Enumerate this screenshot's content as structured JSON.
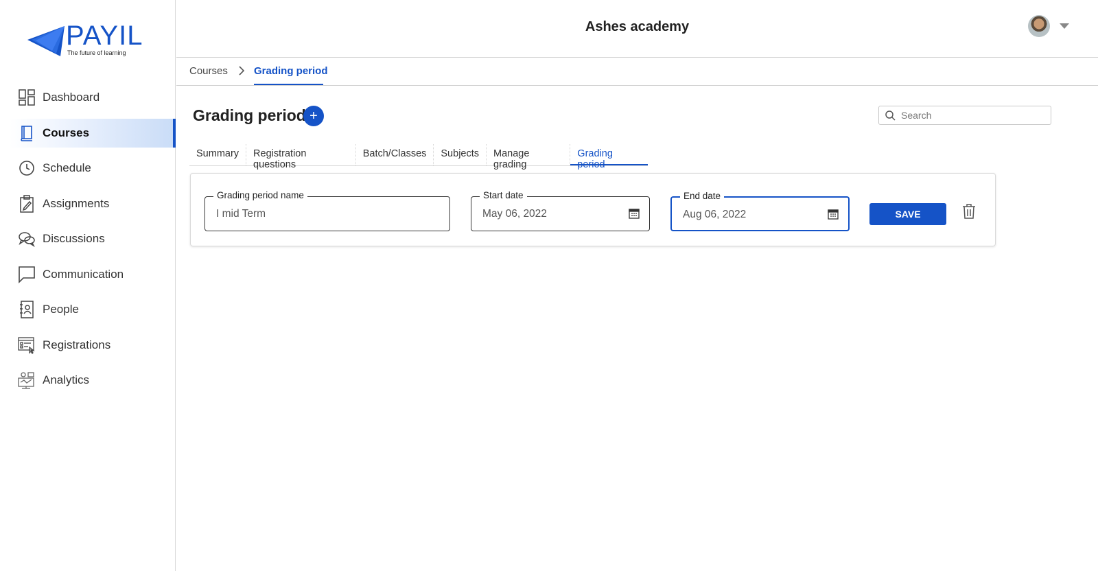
{
  "logo": {
    "name": "PAYIL",
    "tagline": "The future of learning"
  },
  "sidebar": {
    "items": [
      {
        "label": "Dashboard",
        "icon": "dashboard-icon"
      },
      {
        "label": "Courses",
        "icon": "book-icon",
        "active": true
      },
      {
        "label": "Schedule",
        "icon": "clock-icon"
      },
      {
        "label": "Assignments",
        "icon": "clipboard-pencil-icon"
      },
      {
        "label": "Discussions",
        "icon": "chat-bubbles-icon"
      },
      {
        "label": "Communication",
        "icon": "message-square-icon"
      },
      {
        "label": "People",
        "icon": "contact-book-icon"
      },
      {
        "label": "Registrations",
        "icon": "registration-form-icon"
      },
      {
        "label": "Analytics",
        "icon": "analytics-icon"
      }
    ]
  },
  "header": {
    "title": "Ashes academy"
  },
  "breadcrumb": {
    "items": [
      "Courses",
      "Grading period"
    ]
  },
  "page": {
    "title": "Grading period"
  },
  "search": {
    "placeholder": "Search"
  },
  "tabs": [
    "Summary",
    "Registration questions",
    "Batch/Classes",
    "Subjects",
    "Manage grading",
    "Grading period"
  ],
  "active_tab": "Grading period",
  "form": {
    "name_label": "Grading period name",
    "name_value": "I mid Term",
    "start_label": "Start date",
    "start_value": "May 06, 2022",
    "end_label": "End date",
    "end_value": "Aug 06, 2022",
    "save_label": "SAVE"
  },
  "colors": {
    "accent": "#1553c7"
  }
}
